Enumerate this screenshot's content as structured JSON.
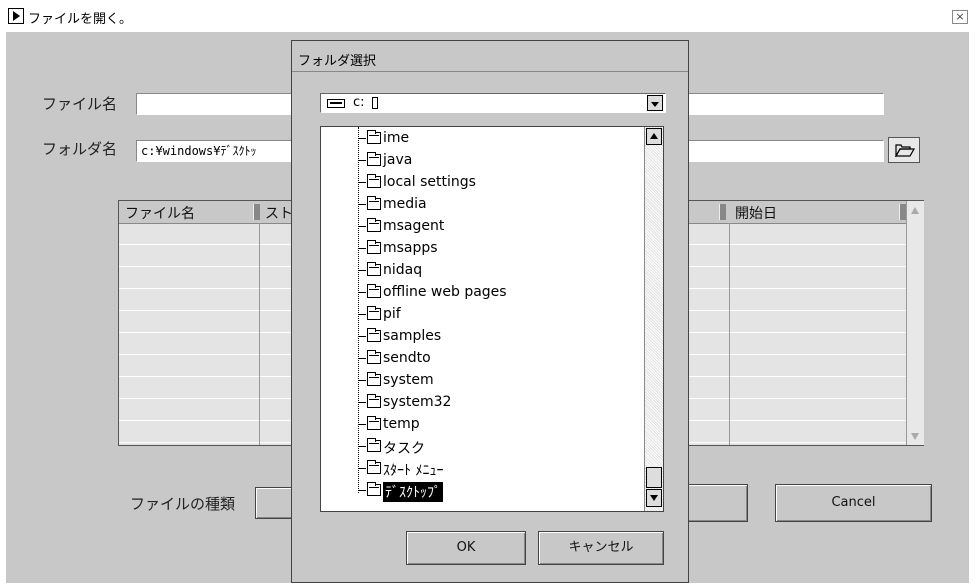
{
  "window": {
    "title": "ファイルを開く。",
    "close_glyph": "×"
  },
  "form": {
    "filename_label": "ファイル名",
    "filename_value": "",
    "folder_label": "フォルダ名",
    "folder_value": "c:¥windows¥ﾃﾞｽｸﾄｯ",
    "filetype_label": "ファイルの種類",
    "cancel_label": "Cancel"
  },
  "table": {
    "columns": [
      "ファイル名",
      "スト",
      "開始日"
    ],
    "rows": 10
  },
  "dialog": {
    "title": "フォルダ選択",
    "drive_value": "c:",
    "tree_items": [
      "ime",
      "java",
      "local settings",
      "media",
      "msagent",
      "msapps",
      "nidaq",
      "offline web pages",
      "pif",
      "samples",
      "sendto",
      "system",
      "system32",
      "temp",
      "タスク",
      "ｽﾀｰﾄ ﾒﾆｭｰ",
      "ﾃﾞｽｸﾄｯﾌﾟ"
    ],
    "selected_item": "ﾃﾞｽｸﾄｯﾌﾟ",
    "ok_label": "OK",
    "cancel_label": "キャンセル"
  }
}
